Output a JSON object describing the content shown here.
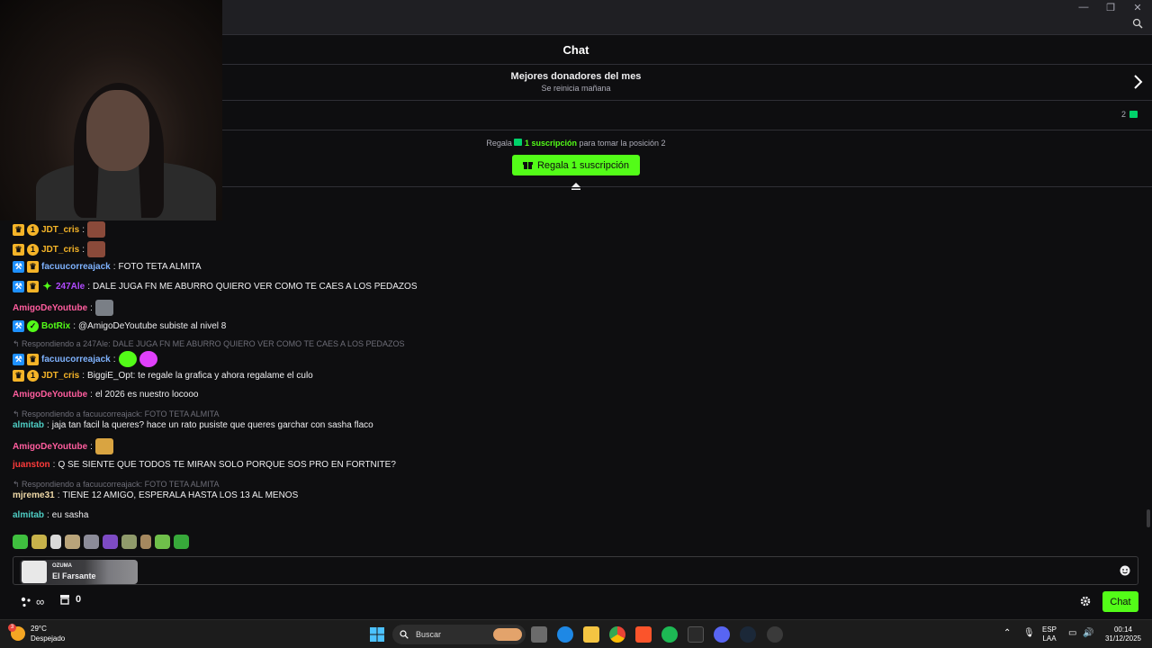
{
  "header": {
    "title": "Chat"
  },
  "donors": {
    "title": "Mejores donadores del mes",
    "subtitle": "Se reinicia mañana"
  },
  "rank": {
    "count": "2"
  },
  "gift": {
    "prefix": "Regala",
    "highlight": "1 suscripción",
    "suffix": "para tomar la posición 2",
    "button_label": "Regala 1 suscripción"
  },
  "messages": [
    {
      "user": "JDT_cris",
      "color": "#f5b428",
      "text": ""
    },
    {
      "user": "JDT_cris",
      "color": "#f5b428",
      "text": ""
    },
    {
      "user": "facuucorreajack",
      "color": "#7fb3ff",
      "text": "FOTO TETA ALMITA"
    },
    {
      "user": "247Ale",
      "color": "#b14aff",
      "text": "DALE JUGA FN ME ABURRO QUIERO VER COMO TE CAES A LOS PEDAZOS"
    },
    {
      "user": "AmigoDeYoutube",
      "color": "#ff5d9e",
      "text": ""
    },
    {
      "user": "BotRix",
      "color": "#53fc18",
      "text": "@AmigoDeYoutube subiste al nivel 8"
    },
    {
      "reply": "Respondiendo a 247Ale: DALE JUGA FN ME ABURRO QUIERO VER COMO TE CAES A LOS PEDAZOS"
    },
    {
      "user": "facuucorreajack",
      "color": "#7fb3ff",
      "text": ""
    },
    {
      "user": "JDT_cris",
      "color": "#f5b428",
      "text": "BiggiE_Opt: te regale la grafica y ahora regalame el culo"
    },
    {
      "user": "AmigoDeYoutube",
      "color": "#ff5d9e",
      "text": "el 2026 es nuestro locooo"
    },
    {
      "reply": "Respondiendo a facuucorreajack: FOTO TETA ALMITA"
    },
    {
      "user": "almitab",
      "color": "#4ecdc4",
      "text": "jaja tan facil la queres? hace un rato pusiste que queres garchar con sasha flaco"
    },
    {
      "user": "AmigoDeYoutube",
      "color": "#ff5d9e",
      "text": ""
    },
    {
      "user": "juanston",
      "color": "#ff3b3b",
      "text": "Q SE SIENTE QUE TODOS TE MIRAN SOLO PORQUE SOS PRO EN FORTNITE?"
    },
    {
      "reply": "Respondiendo a facuucorreajack: FOTO TETA ALMITA"
    },
    {
      "user": "mjreme31",
      "color": "#f0d9a8",
      "text": "TIENE 12 AMIGO, ESPERALA HASTA LOS 13 AL MENOS"
    },
    {
      "user": "almitab",
      "color": "#4ecdc4",
      "text": "eu sasha"
    }
  ],
  "input": {
    "reward_small": "OZUMA",
    "reward_name": "El Farsante"
  },
  "bottom": {
    "points": "∞",
    "store_count": "0",
    "chat_button": "Chat"
  },
  "taskbar": {
    "temp": "29°C",
    "weather": "Despejado",
    "search": "Buscar",
    "lang1": "ESP",
    "lang2": "LAA",
    "time": "00:14",
    "date": "31/12/2025",
    "weather_badge": "3"
  },
  "colors": {
    "accent": "#53fc18",
    "bg": "#0e0e10"
  }
}
